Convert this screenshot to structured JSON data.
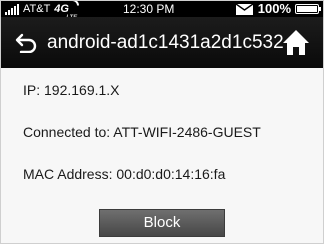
{
  "status_bar": {
    "carrier": "AT&T",
    "network": "4G",
    "network_sub": "LTE",
    "time": "12:30 PM",
    "battery_percent": "100%",
    "battery_level": 1.0,
    "icons": [
      "signal-bars-icon",
      "envelope-icon",
      "battery-icon"
    ]
  },
  "titlebar": {
    "title": "android-ad1c1431a2d1c532",
    "icons": [
      "back-arrow-icon",
      "home-icon"
    ]
  },
  "device": {
    "ip_line": "IP: 192.169.1.X",
    "connected_line": "Connected to: ATT-WIFI-2486-GUEST",
    "mac_line": "MAC Address: 00:d0:d0:14:16:fa"
  },
  "actions": {
    "block_label": "Block"
  },
  "colors": {
    "titlebar_bg": "#111111",
    "content_bg": "#f7f7f7",
    "button_bg": "#5a5a5a",
    "text": "#1a1a1a"
  }
}
